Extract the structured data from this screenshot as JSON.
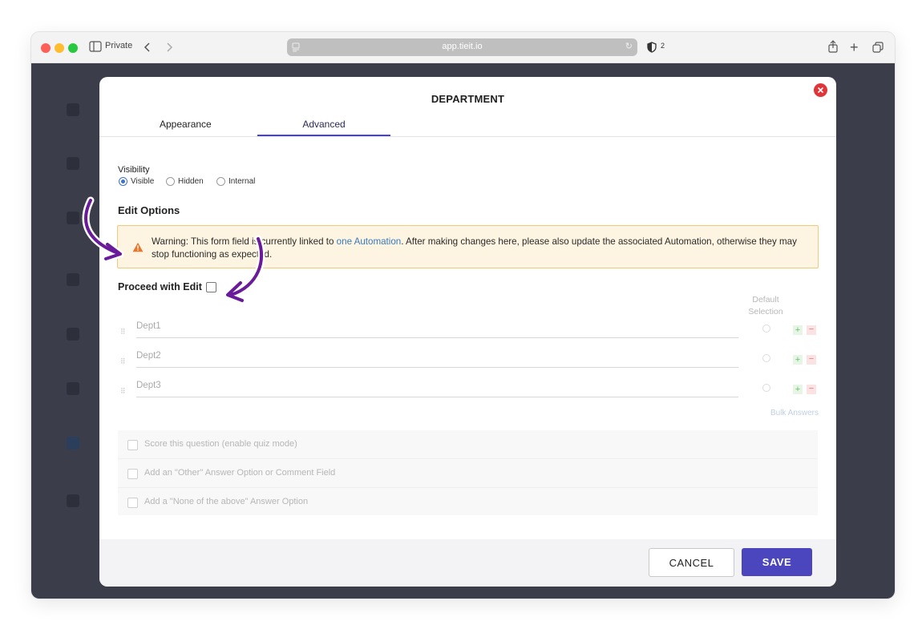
{
  "browser": {
    "mode_label": "Private",
    "url": "app.tieit.io",
    "shield_count": "2"
  },
  "modal": {
    "title": "DEPARTMENT",
    "tabs": [
      {
        "label": "Appearance",
        "active": false
      },
      {
        "label": "Advanced",
        "active": true
      }
    ]
  },
  "visibility": {
    "label": "Visibility",
    "options": [
      {
        "label": "Visible",
        "checked": true
      },
      {
        "label": "Hidden",
        "checked": false
      },
      {
        "label": "Internal",
        "checked": false
      }
    ]
  },
  "edit_options": {
    "heading": "Edit Options",
    "warning": {
      "prefix": "Warning: This form field is currently linked to ",
      "link": "one Automation",
      "suffix": ". After making changes here, please also update the associated Automation, otherwise they may stop functioning as expected."
    },
    "proceed_label": "Proceed with Edit"
  },
  "answers": {
    "default_selection_label": "Default Selection",
    "items": [
      "Dept1",
      "Dept2",
      "Dept3"
    ],
    "plus": "+",
    "minus": "−",
    "bulk_label": "Bulk Answers"
  },
  "extra_options": [
    "Score this question (enable quiz mode)",
    "Add an \"Other\" Answer Option or Comment Field",
    "Add a \"None of the above\" Answer Option"
  ],
  "footer": {
    "cancel_label": "CANCEL",
    "save_label": "SAVE"
  },
  "colors": {
    "accent": "#4b46be",
    "annotation_arrow": "#6a1b9a",
    "warning_bg": "#fdf5e2",
    "warning_icon": "#e8772e",
    "close": "#e0363a"
  }
}
